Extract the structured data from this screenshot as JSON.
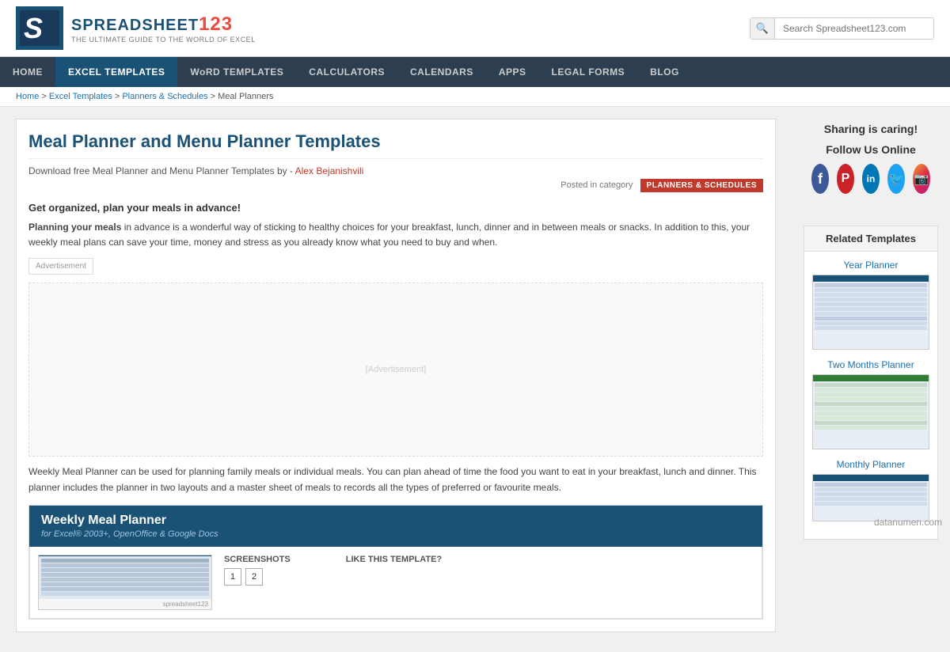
{
  "header": {
    "logo_letter": "S",
    "logo_title": "SPREAD SHEET 123",
    "logo_subtitle": "THE ULTIMATE GUIDE TO THE WORLD OF EXCEL",
    "search_placeholder": "Search Spreadsheet123.com"
  },
  "nav": {
    "items": [
      {
        "label": "HOME",
        "active": false,
        "id": "home"
      },
      {
        "label": "EXCEL TEMPLATES",
        "active": true,
        "id": "excel-templates"
      },
      {
        "label": "WoRD TEMPLATES",
        "active": false,
        "id": "word-templates"
      },
      {
        "label": "CALCULATORS",
        "active": false,
        "id": "calculators"
      },
      {
        "label": "CALENDARS",
        "active": false,
        "id": "calendars"
      },
      {
        "label": "APPS",
        "active": false,
        "id": "apps"
      },
      {
        "label": "LEGAL FORMS",
        "active": false,
        "id": "legal-forms"
      },
      {
        "label": "BLOG",
        "active": false,
        "id": "blog"
      }
    ]
  },
  "breadcrumb": {
    "items": [
      {
        "label": "Home",
        "href": "#"
      },
      {
        "label": "Excel Templates",
        "href": "#"
      },
      {
        "label": "Planners & Schedules",
        "href": "#"
      },
      {
        "label": "Meal Planners",
        "href": null
      }
    ]
  },
  "article": {
    "title": "Meal Planner and Menu Planner Templates",
    "subtitle_prefix": "Download free Meal Planner and Menu Planner Templates by -",
    "author": "Alex Bejanishvili",
    "category_label": "Posted in category",
    "category_badge": "PLANNERS & SCHEDULES",
    "intro_bold": "Get organized, plan your meals in advance!",
    "body_bold": "Planning your meals",
    "body_text": " in advance is a wonderful way of sticking to healthy choices for your breakfast, lunch, dinner and in between meals or snacks. In addition to this, your weekly meal plans can save your time, money and stress as you already know what you need to buy and when.",
    "ad_label": "Advertisement",
    "second_para": "Weekly Meal Planner can be used for planning family meals or individual meals. You can plan ahead of time the food you want to eat in your breakfast, lunch and dinner. This planner includes the planner in two layouts and a master sheet of meals to records all the types of preferred or favourite meals.",
    "template_card": {
      "title": "Weekly Meal Planner",
      "subtitle": "for Excel® 2003+, OpenOffice & Google Docs",
      "screenshots_label": "SCREENSHOTS",
      "screenshot_nums": [
        "1",
        "2"
      ],
      "like_label": "LIKE THIS TEMPLATE?"
    }
  },
  "sidebar": {
    "sharing_title": "Sharing is caring!",
    "follow_title": "Follow Us Online",
    "social": [
      {
        "name": "facebook",
        "class": "fb",
        "symbol": "f"
      },
      {
        "name": "pinterest",
        "class": "pi",
        "symbol": "P"
      },
      {
        "name": "linkedin",
        "class": "li",
        "symbol": "in"
      },
      {
        "name": "twitter",
        "class": "tw",
        "symbol": "t"
      },
      {
        "name": "instagram",
        "class": "ig",
        "symbol": "📷"
      }
    ],
    "related_title": "Related Templates",
    "related": [
      {
        "name": "Year Planner",
        "id": "year-planner"
      },
      {
        "name": "Two Months Planner",
        "id": "two-months-planner"
      },
      {
        "name": "Monthly Planner",
        "id": "monthly-planner"
      }
    ]
  },
  "watermark": "datanumen.com"
}
